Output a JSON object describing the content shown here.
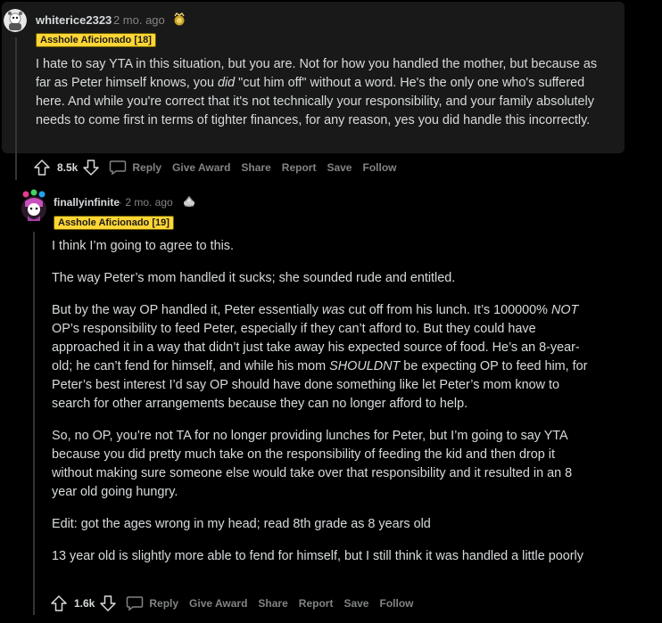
{
  "comments": [
    {
      "username": "whiterice2323",
      "time": " · 2 mo. ago",
      "flair": "Asshole Aficionado [18]",
      "paragraphs": [
        [
          "I hate to say YTA in this situation, but you are. Not for how you handled the mother, but because as far as Peter himself knows, you ",
          {
            "em": "did"
          },
          " \"cut him off\" without a word. He's the only one who's suffered here. And while you're correct that it's not technically your responsibility, and your family absolutely needs to come first in terms of tighter finances, for any reason, yes you did handle this incorrectly."
        ]
      ],
      "votes": "8.5k",
      "actions": [
        "Reply",
        "Give Award",
        "Share",
        "Report",
        "Save",
        "Follow"
      ]
    },
    {
      "username": "finallyinfinite",
      "time": " · 2 mo. ago",
      "flair": "Asshole Aficionado [19]",
      "paragraphs": [
        [
          "I think I’m going to agree to this."
        ],
        [
          "The way Peter’s mom handled it sucks; she sounded rude and entitled."
        ],
        [
          "But by the way OP handled it, Peter essentially ",
          {
            "em": "was"
          },
          " cut off from his lunch. It’s 100000% ",
          {
            "em": "NOT"
          },
          " OP’s responsibility to feed Peter, especially if they can’t afford to. But they could have approached it in a way that didn’t just take away his expected source of food. He’s an 8-year-old; he can’t fend for himself, and while his mom ",
          {
            "em": "SHOULDNT"
          },
          " be expecting OP to feed him, for Peter’s best interest I’d say OP should have done something like let Peter’s mom know to search for other arrangements because they can no longer afford to help."
        ],
        [
          "So, no OP, you’re not TA for no longer providing lunches for Peter, but I’m going to say YTA because you did pretty much take on the responsibility of feeding the kid and then drop it without making sure someone else would take over that responsibility and it resulted in an 8 year old going hungry."
        ],
        [
          "Edit: got the ages wrong in my head; read 8th grade as 8 years old"
        ],
        [
          "13 year old is slightly more able to fend for himself, but I still think it was handled a little poorly"
        ]
      ],
      "votes": "1.6k",
      "actions": [
        "Reply",
        "Give Award",
        "Share",
        "Report",
        "Save",
        "Follow"
      ]
    }
  ],
  "icons": {
    "upvote": "arrow-up-icon",
    "downvote": "arrow-down-icon",
    "reply": "speech-bubble-icon",
    "award": "trophy-award-icon"
  },
  "colors": {
    "background": "#000000",
    "highlight_card": "#191919",
    "text": "#d7dadc",
    "meta": "#818384",
    "flair_bg": "#ffd635"
  }
}
